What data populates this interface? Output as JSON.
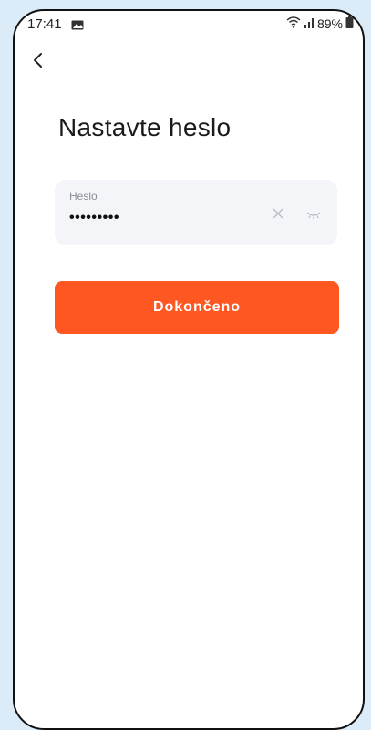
{
  "status_bar": {
    "time": "17:41",
    "battery": "89%",
    "icons": [
      "gallery-icon",
      "wifi-icon",
      "signal-icon",
      "battery-icon"
    ]
  },
  "header": {
    "back_icon": "chevron-left-icon"
  },
  "main": {
    "title": "Nastavte heslo",
    "password_field": {
      "label": "Heslo",
      "value": "•••••••••",
      "clear_icon": "close-icon",
      "visibility_icon": "eye-closed-icon"
    },
    "done_button": "Dokončeno"
  },
  "colors": {
    "accent": "#ff5722",
    "field_bg": "#f4f5f9",
    "page_bg": "#dcebf8"
  }
}
